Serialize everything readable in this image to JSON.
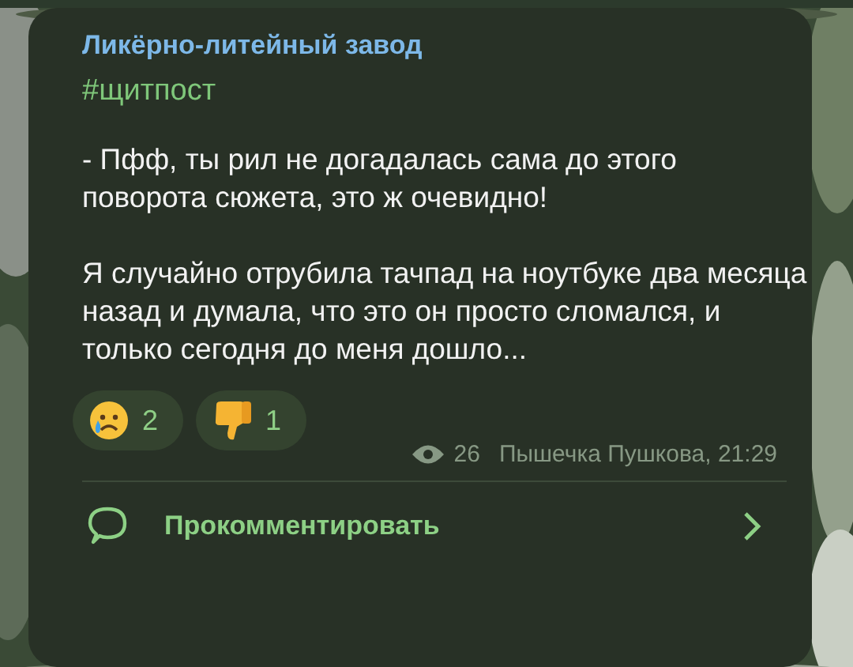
{
  "channel": {
    "name": "Ликёрно-литейный завод"
  },
  "post": {
    "hashtag": "#щитпост",
    "paragraphs": [
      "- Пфф, ты рил не догадалась сама до этого поворота сюжета, это ж очевидно!",
      "Я случайно отрубила тачпад на ноутбуке два месяца назад и думала, что это он просто сломался, и только сегодня до меня дошло..."
    ]
  },
  "reactions": [
    {
      "kind": "crying",
      "count": "2"
    },
    {
      "kind": "thumbs_down",
      "count": "1"
    }
  ],
  "meta": {
    "views": "26",
    "author_time": "Пышечка Пушкова, 21:29"
  },
  "comment_button": {
    "label": "Прокомментировать"
  }
}
